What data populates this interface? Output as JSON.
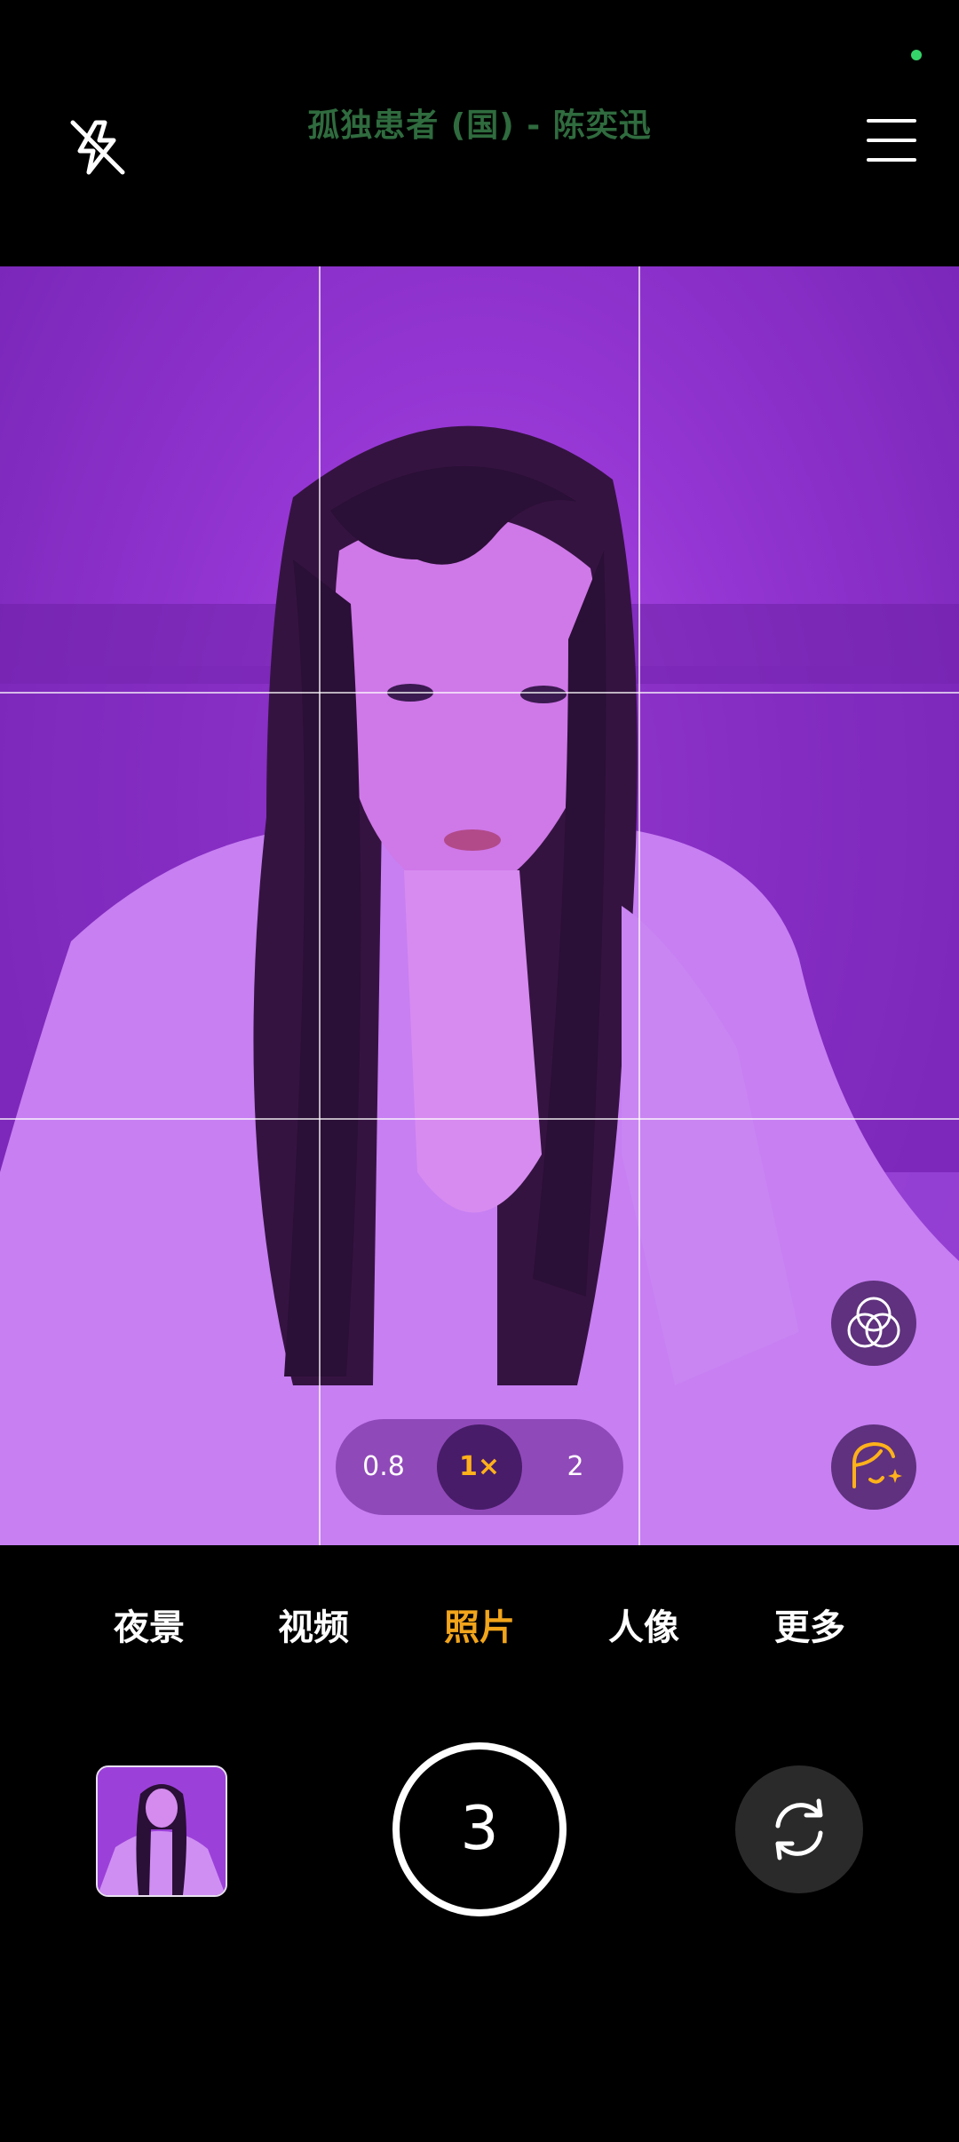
{
  "top_bar": {
    "now_playing": "孤独患者 (国) - 陈奕迅",
    "flash_icon": "flash-off-icon",
    "menu_icon": "hamburger-menu-icon",
    "status_dot_color": "#35d46a"
  },
  "zoom": {
    "options": [
      "0.8",
      "1×",
      "2"
    ],
    "active": "1×"
  },
  "side_controls": {
    "filter_icon": "filter-circles-icon",
    "beauty_icon": "beauty-face-icon"
  },
  "modes": {
    "items": [
      "夜景",
      "视频",
      "照片",
      "人像",
      "更多"
    ],
    "active": "照片"
  },
  "bottom": {
    "countdown": "3",
    "switch_icon": "switch-camera-icon",
    "gallery_thumbnail": "last-photo-thumbnail"
  },
  "colors": {
    "accent": "#f2a51b",
    "viewfinder_tint": "#9335d2",
    "now_playing": "#2f6b3e"
  }
}
